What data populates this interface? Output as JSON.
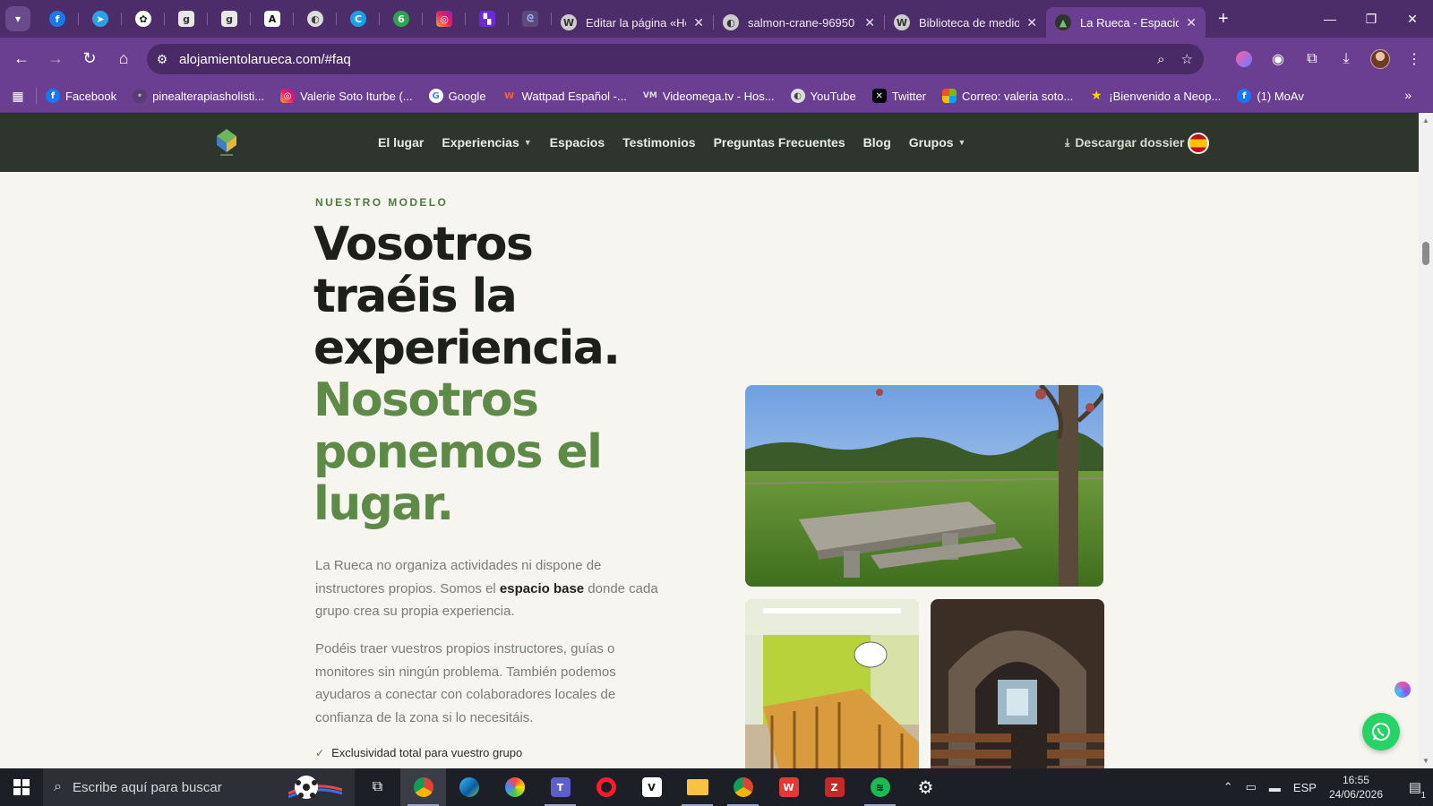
{
  "browser": {
    "tabs": [
      {
        "title": "Editar la página «Hor"
      },
      {
        "title": "salmon-crane-96950"
      },
      {
        "title": "Biblioteca de medios"
      },
      {
        "title": "La Rueca - Espacio p"
      }
    ],
    "url": "alojamientolarueca.com/#faq",
    "bookmarks": [
      {
        "label": "Facebook"
      },
      {
        "label": "pinealterapiasholisti..."
      },
      {
        "label": "Valerie Soto Iturbe (..."
      },
      {
        "label": "Google"
      },
      {
        "label": "Wattpad Español -..."
      },
      {
        "label": "Videomega.tv - Hos..."
      },
      {
        "label": "YouTube"
      },
      {
        "label": "Twitter"
      },
      {
        "label": "Correo: valeria soto..."
      },
      {
        "label": "¡Bienvenido a Neop..."
      },
      {
        "label": "(1) MoAv"
      }
    ]
  },
  "site": {
    "nav": [
      "El lugar",
      "Experiencias",
      "Espacios",
      "Testimonios",
      "Preguntas Frecuentes",
      "Blog",
      "Grupos"
    ],
    "dossier": "Descargar dossier",
    "eyebrow": "NUESTRO MODELO",
    "headline_dark": [
      "Vosotros",
      "traéis la",
      "experiencia."
    ],
    "headline_green": [
      "Nosotros",
      "ponemos el",
      "lugar."
    ],
    "p1_before": "La Rueca no organiza actividades ni dispone de instructores propios. Somos el ",
    "p1_bold": "espacio base",
    "p1_after": " donde cada grupo crea su propia experiencia.",
    "p2": "Podéis traer vuestros propios instructores, guías o monitores sin ningún problema. También podemos ayudaros a conectar con colaboradores locales de confianza de la zona si lo necesitáis.",
    "check_item": "Exclusividad total para vuestro grupo"
  },
  "taskbar": {
    "search_placeholder": "Escribe aquí para buscar",
    "lang": "ESP",
    "time": "16:55",
    "date": "24/06/2026",
    "notif_count": "1"
  }
}
